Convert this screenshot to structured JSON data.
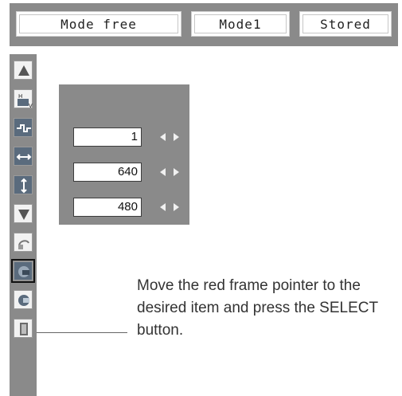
{
  "header": {
    "mode_free": "Mode free",
    "mode1": "Mode1",
    "stored": "Stored"
  },
  "sidebar": {
    "items": [
      {
        "name": "up-arrow-icon"
      },
      {
        "name": "horizontal-vertical-icon"
      },
      {
        "name": "fine-sync-icon"
      },
      {
        "name": "total-dots-icon"
      },
      {
        "name": "vertical-position-icon"
      },
      {
        "name": "down-arrow-icon"
      },
      {
        "name": "reset-icon"
      },
      {
        "name": "mode-free-icon"
      },
      {
        "name": "store-icon"
      },
      {
        "name": "quit-icon"
      }
    ]
  },
  "panel": {
    "rows": [
      {
        "value": "1"
      },
      {
        "value": "640"
      },
      {
        "value": "480"
      }
    ]
  },
  "callout": {
    "text": "Move the red frame pointer to the desired item and press the SELECT button."
  }
}
